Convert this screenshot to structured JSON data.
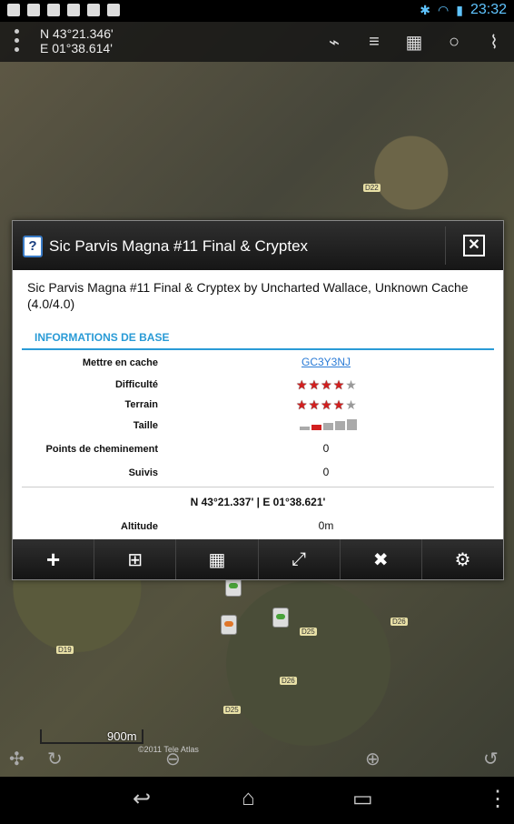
{
  "status_bar": {
    "time": "23:32"
  },
  "map_top": {
    "coord_lat": "N 43°21.346'",
    "coord_lon": "E 01°38.614'"
  },
  "map": {
    "scale_label": "900m",
    "copyright": "©2011 Tele Atlas",
    "road_labels": [
      "D22",
      "D25",
      "D19",
      "D26",
      "D25",
      "D26"
    ]
  },
  "dialog": {
    "title": "Sic Parvis Magna #11 Final & Cryptex",
    "description": "Sic Parvis Magna #11 Final & Cryptex by Uncharted Wallace, Unknown Cache (4.0/4.0)",
    "section_title": "INFORMATIONS DE BASE",
    "rows": {
      "cache_label": "Mettre en cache",
      "cache_code": "GC3Y3NJ",
      "difficulty_label": "Difficulté",
      "difficulty_stars": 4,
      "terrain_label": "Terrain",
      "terrain_stars": 4,
      "size_label": "Taille",
      "waypoints_label": "Points de cheminement",
      "waypoints_value": "0",
      "tracks_label": "Suivis",
      "tracks_value": "0",
      "coordinates": "N 43°21.337' | E 01°38.621'",
      "altitude_label": "Altitude",
      "altitude_value": "0m"
    },
    "colors": {
      "accent": "#2a9bd6",
      "star_on": "#d21f1f"
    },
    "bottom_icons": [
      "add-icon",
      "navigate-icon",
      "map-icon",
      "compass-icon",
      "tools-icon",
      "settings-icon"
    ]
  }
}
